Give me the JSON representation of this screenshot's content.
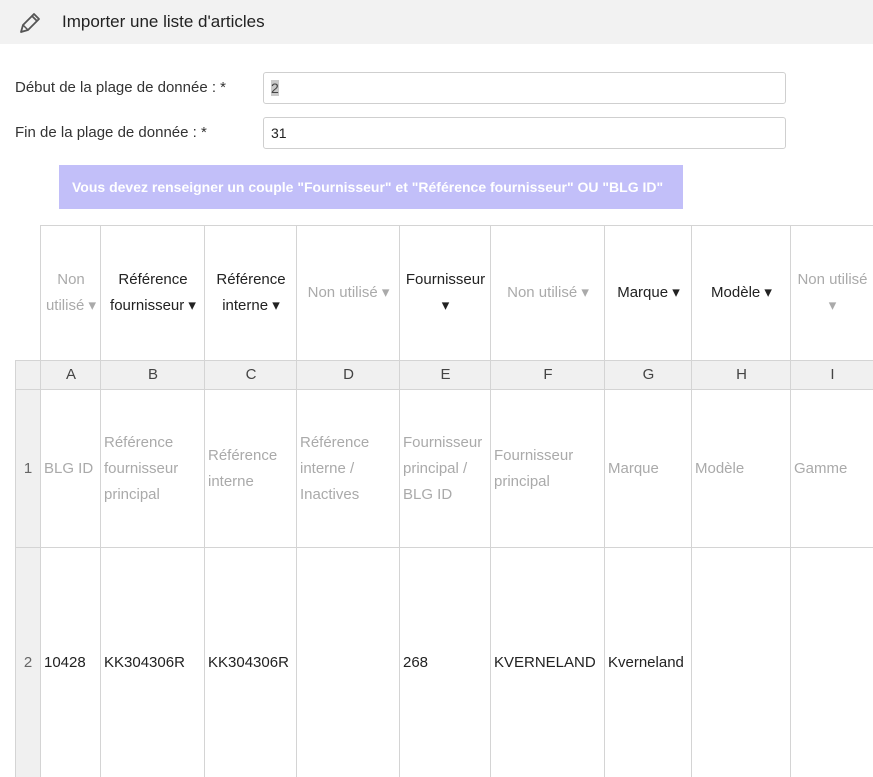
{
  "header": {
    "title": "Importer une liste d'articles",
    "icon": "pencil-icon"
  },
  "form": {
    "start_label": "Début de la plage de donnée : *",
    "start_value": "2",
    "end_label": "Fin de la plage de donnée : *",
    "end_value": "31"
  },
  "warning": "Vous devez renseigner un couple \"Fournisseur\" et \"Référence fournisseur\" OU \"BLG ID\"",
  "colors": {
    "warning_bg": "#c2bff9",
    "header_bg": "#f2f2f2"
  },
  "columns": [
    {
      "letter": "A",
      "mapping": "Non utilisé ▾",
      "used": false
    },
    {
      "letter": "B",
      "mapping": "Référence fournisseur ▾",
      "used": true
    },
    {
      "letter": "C",
      "mapping": "Référence interne ▾",
      "used": true
    },
    {
      "letter": "D",
      "mapping": "Non utilisé ▾",
      "used": false
    },
    {
      "letter": "E",
      "mapping": "Fournisseur ▾",
      "used": true
    },
    {
      "letter": "F",
      "mapping": "Non utilisé ▾",
      "used": false
    },
    {
      "letter": "G",
      "mapping": "Marque ▾",
      "used": true
    },
    {
      "letter": "H",
      "mapping": "Modèle ▾",
      "used": true
    },
    {
      "letter": "I",
      "mapping": "Non utilisé ▾",
      "used": false
    }
  ],
  "rows": [
    {
      "num": "1",
      "cells": [
        "BLG ID",
        "Référence fournisseur principal",
        "Référence interne",
        "Référence interne / Inactives",
        "Fournisseur principal / BLG ID",
        "Fournisseur principal",
        "Marque",
        "Modèle",
        "Gamme"
      ]
    },
    {
      "num": "2",
      "cells": [
        "10428",
        "KK304306R",
        "KK304306R",
        "",
        "268",
        "KVERNELAND",
        "Kverneland",
        "",
        ""
      ]
    }
  ]
}
